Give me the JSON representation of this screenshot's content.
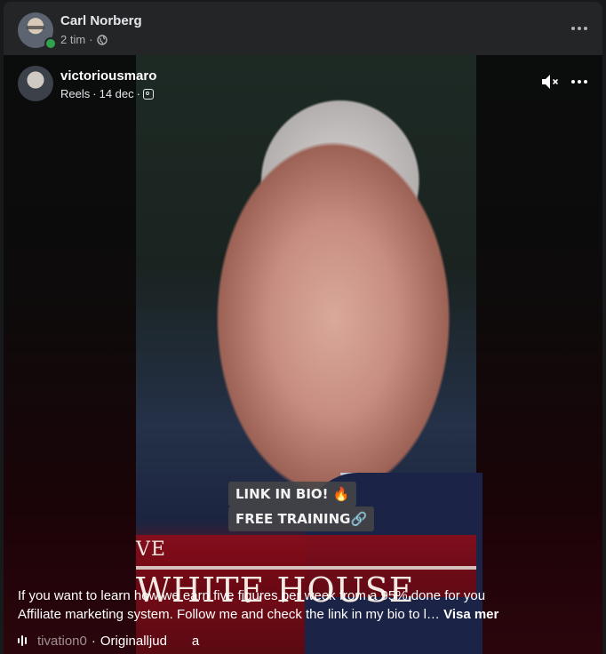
{
  "post": {
    "author": "Carl Norberg",
    "time": "2 tim",
    "separator": "·",
    "privacy_icon": "globe-icon",
    "more_icon": "more-horizontal-icon"
  },
  "reel": {
    "author": "victoriousmaro",
    "source": "Reels",
    "date": "14 dec",
    "sep1": "·",
    "sep2": "·",
    "platform_icon": "instagram-icon",
    "mute_icon": "volume-muted-icon",
    "more_icon": "more-horizontal-icon"
  },
  "video": {
    "sticker_line1": "LINK IN BIO! 🔥",
    "sticker_line2": "FREE TRAINING🔗",
    "chyron_small": "VE",
    "chyron_big": "WHITE HOUSE"
  },
  "caption": {
    "text": "If you want to learn how we earn five figures per week from a 95% done for you Affiliate marketing system. Follow me and check the link in my bio to l…",
    "see_more": "Visa mer"
  },
  "audio": {
    "icon": "audio-wave-icon",
    "title_fragment": "tivation0",
    "separator": "·",
    "label": "Originalljud",
    "extra": "a"
  },
  "colors": {
    "card_bg": "#242526",
    "online": "#31a24c",
    "chyron_red": "#8c0c19"
  }
}
